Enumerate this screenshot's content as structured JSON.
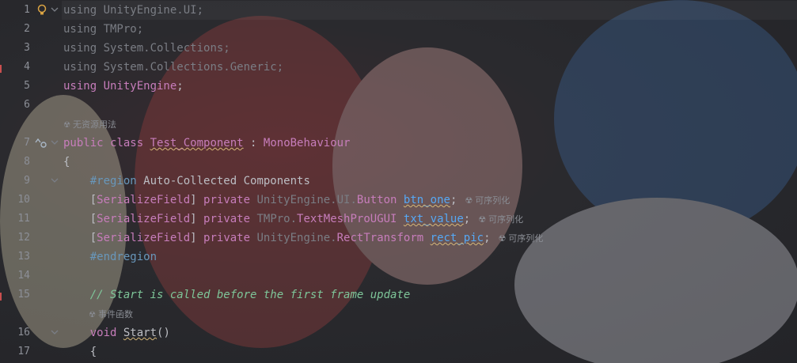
{
  "editor": {
    "lines": [
      {
        "num": "1",
        "segments": [
          {
            "t": "using ",
            "c": "dim"
          },
          {
            "t": "UnityEngine.UI",
            "c": "dim"
          },
          {
            "t": ";",
            "c": "dim"
          }
        ]
      },
      {
        "num": "2",
        "segments": [
          {
            "t": "using ",
            "c": "dim"
          },
          {
            "t": "TMPro",
            "c": "dim"
          },
          {
            "t": ";",
            "c": "dim"
          }
        ]
      },
      {
        "num": "3",
        "segments": [
          {
            "t": "using ",
            "c": "dim"
          },
          {
            "t": "System.Collections",
            "c": "dim"
          },
          {
            "t": ";",
            "c": "dim"
          }
        ]
      },
      {
        "num": "4",
        "segments": [
          {
            "t": "using ",
            "c": "dim"
          },
          {
            "t": "System.Collections.Generic",
            "c": "dim"
          },
          {
            "t": ";",
            "c": "dim"
          }
        ]
      },
      {
        "num": "5",
        "segments": [
          {
            "t": "using ",
            "c": "kw2"
          },
          {
            "t": "UnityEngine",
            "c": "type"
          },
          {
            "t": ";",
            "c": "plain"
          }
        ]
      },
      {
        "num": "6",
        "segments": []
      },
      {
        "num": "7",
        "segments": [
          {
            "t": "public ",
            "c": "kw2"
          },
          {
            "t": "class ",
            "c": "kw2"
          },
          {
            "t": "Test_Component",
            "c": "cls"
          },
          {
            "t": " : ",
            "c": "plain"
          },
          {
            "t": "MonoBehaviour",
            "c": "type"
          }
        ]
      },
      {
        "num": "8",
        "segments": [
          {
            "t": "{",
            "c": "plain"
          }
        ]
      },
      {
        "num": "9",
        "segments": [
          {
            "t": "    ",
            "c": "plain"
          },
          {
            "t": "#region",
            "c": "region"
          },
          {
            "t": " Auto-Collected Components",
            "c": "plain"
          }
        ]
      },
      {
        "num": "10",
        "segments": [
          {
            "t": "    [",
            "c": "plain"
          },
          {
            "t": "SerializeField",
            "c": "type"
          },
          {
            "t": "] ",
            "c": "plain"
          },
          {
            "t": "private ",
            "c": "kw2"
          },
          {
            "t": "UnityEngine.UI.",
            "c": "dim"
          },
          {
            "t": "Button",
            "c": "type"
          },
          {
            "t": " ",
            "c": "plain"
          },
          {
            "t": "btn_one",
            "c": "fld-under"
          },
          {
            "t": ";",
            "c": "plain"
          }
        ],
        "hint": "可序列化"
      },
      {
        "num": "11",
        "segments": [
          {
            "t": "    [",
            "c": "plain"
          },
          {
            "t": "SerializeField",
            "c": "type"
          },
          {
            "t": "] ",
            "c": "plain"
          },
          {
            "t": "private ",
            "c": "kw2"
          },
          {
            "t": "TMPro.",
            "c": "dim"
          },
          {
            "t": "TextMeshProUGUI",
            "c": "type"
          },
          {
            "t": " ",
            "c": "plain"
          },
          {
            "t": "txt_value",
            "c": "fld-under"
          },
          {
            "t": ";",
            "c": "plain"
          }
        ],
        "hint": "可序列化"
      },
      {
        "num": "12",
        "segments": [
          {
            "t": "    [",
            "c": "plain"
          },
          {
            "t": "SerializeField",
            "c": "type"
          },
          {
            "t": "] ",
            "c": "plain"
          },
          {
            "t": "private ",
            "c": "kw2"
          },
          {
            "t": "UnityEngine.",
            "c": "dim"
          },
          {
            "t": "RectTransform",
            "c": "type"
          },
          {
            "t": " ",
            "c": "plain"
          },
          {
            "t": "rect_pic",
            "c": "fld-under"
          },
          {
            "t": ";",
            "c": "plain"
          }
        ],
        "hint": "可序列化"
      },
      {
        "num": "13",
        "segments": [
          {
            "t": "    ",
            "c": "plain"
          },
          {
            "t": "#endregion",
            "c": "region"
          }
        ]
      },
      {
        "num": "14",
        "segments": []
      },
      {
        "num": "15",
        "segments": [
          {
            "t": "    ",
            "c": "plain"
          },
          {
            "t": "// Start is called before the first frame update",
            "c": "comment"
          }
        ]
      },
      {
        "num": "16",
        "segments": [
          {
            "t": "    ",
            "c": "plain"
          },
          {
            "t": "void ",
            "c": "kw2"
          },
          {
            "t": "Start",
            "c": "method"
          },
          {
            "t": "()",
            "c": "plain"
          }
        ]
      },
      {
        "num": "17",
        "segments": [
          {
            "t": "    {",
            "c": "plain"
          }
        ]
      }
    ],
    "block_hints": {
      "class_hint": "无资源用法",
      "method_hint": "事件函数"
    },
    "icons": {
      "bulb": "lightbulb-icon",
      "override": "override-gutter-icon",
      "fold": "chevron-down-icon",
      "unity": "unity-icon"
    }
  }
}
